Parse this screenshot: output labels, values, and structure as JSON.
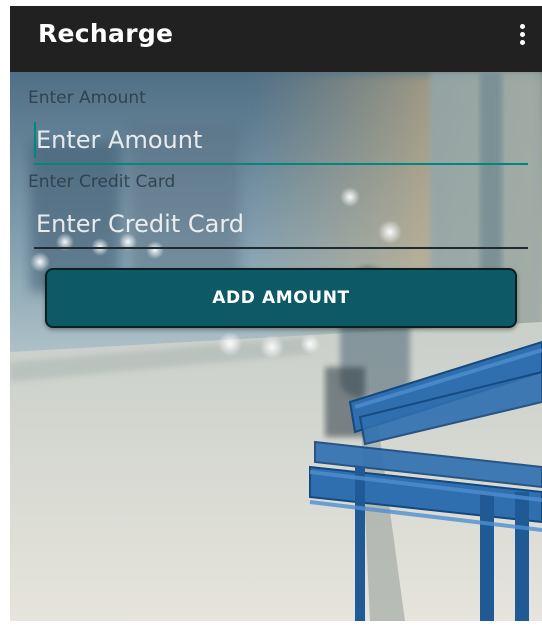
{
  "app_bar": {
    "title": "Recharge",
    "overflow_icon": "more-vert-icon"
  },
  "form": {
    "amount": {
      "label": "Enter Amount",
      "placeholder": "Enter Amount",
      "value": ""
    },
    "credit_card": {
      "label": "Enter Credit Card",
      "placeholder": "Enter Credit Card",
      "value": ""
    },
    "submit_label": "ADD AMOUNT"
  },
  "colors": {
    "app_bar": "#212121",
    "accent": "#00897b",
    "button": "#0d5a66"
  }
}
